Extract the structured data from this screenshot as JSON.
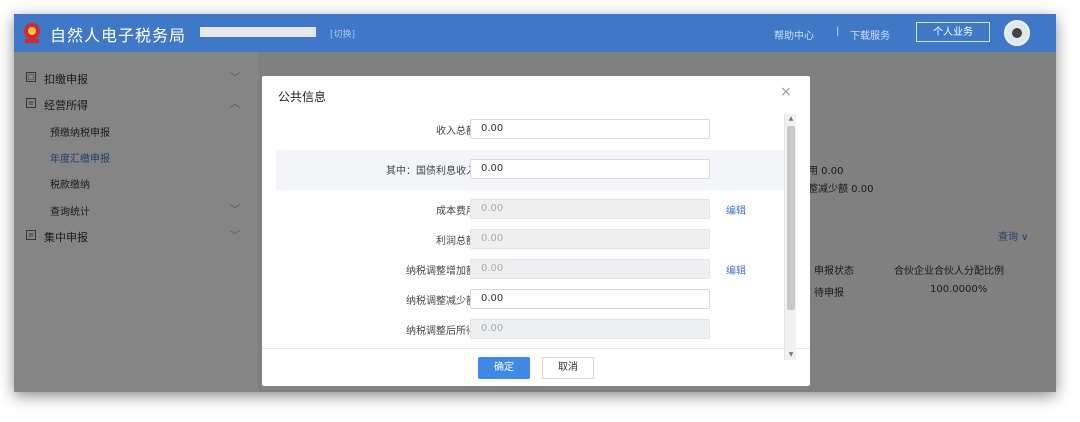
{
  "header": {
    "title": "自然人电子税务局",
    "switch_link": "[切换]",
    "help": "帮助中心",
    "separator": "|",
    "download": "下载服务",
    "personal_button": "个人业务"
  },
  "sidebar": {
    "items": [
      {
        "icon": "form-icon",
        "label": "扣缴申报"
      },
      {
        "icon": "ledger-icon",
        "label": "经营所得"
      },
      {
        "icon": "stack-icon",
        "label": "集中申报"
      }
    ],
    "sub_items": [
      "预缴纳税申报",
      "年度汇缴申报",
      "税款缴纳",
      "查询统计"
    ]
  },
  "background": {
    "cost_text": "用 0.00",
    "reduce_text": "整减少额 0.00",
    "query": "查询 ∨",
    "col_status": "申报状态",
    "col_ratio": "合伙企业合伙人分配比例",
    "cell_status": "待申报",
    "cell_ratio": "100.0000%"
  },
  "modal": {
    "title": "公共信息",
    "close": "×",
    "fields": [
      {
        "label": "收入总额",
        "value": "0.00"
      },
      {
        "label": "其中：国债利息收入",
        "value": "0.00"
      },
      {
        "label": "成本费用",
        "value": "0.00",
        "action": "编辑"
      },
      {
        "label": "利润总额",
        "value": "0.00"
      },
      {
        "label": "纳税调整增加额",
        "value": "0.00",
        "action": "编辑"
      },
      {
        "label": "纳税调整减少额",
        "value": "0.00"
      },
      {
        "label": "纳税调整后所得",
        "value": "0.00"
      }
    ],
    "ok": "确定",
    "cancel": "取消"
  },
  "colors": {
    "brand": "#3f78c7",
    "primary_button": "#3f88e8"
  }
}
